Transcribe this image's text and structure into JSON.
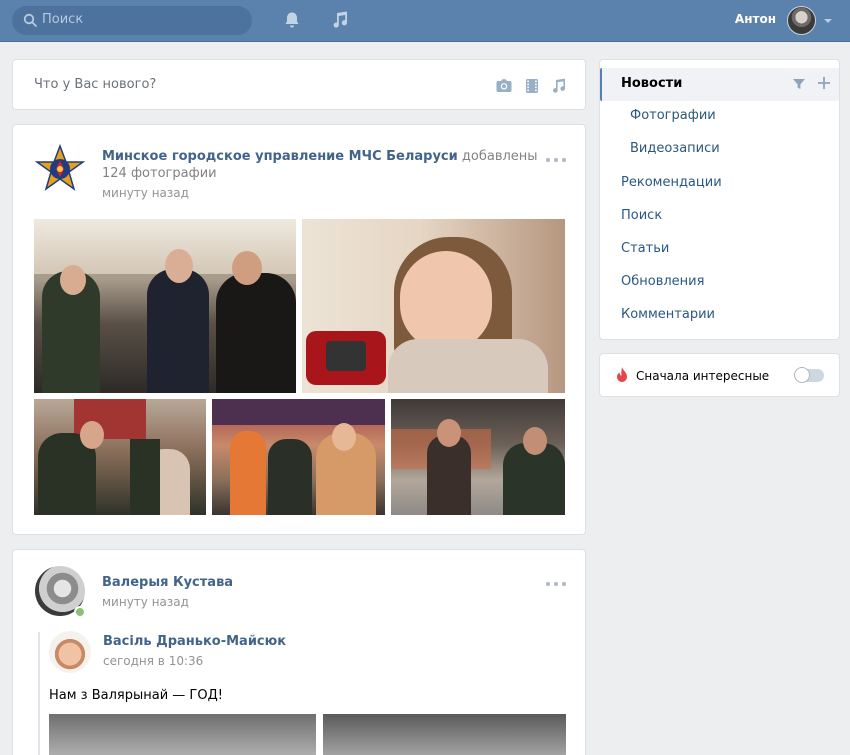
{
  "header": {
    "search_placeholder": "Поиск",
    "user_name": "Антон"
  },
  "composer": {
    "placeholder": "Что у Вас нового?"
  },
  "post1": {
    "author": "Минское городское управление МЧС Беларуси",
    "action": "добавлены 124 фотографии",
    "time": "минуту назад"
  },
  "post2": {
    "author": "Валерыя Кустава",
    "time": "минуту назад",
    "repost": {
      "author": "Васіль Дранько-Майсюк",
      "time": "сегодня в 10:36",
      "text": "Нам з Валярынай — ГОД!"
    }
  },
  "menu": {
    "active": "Новости",
    "items": [
      {
        "label": "Фотографии",
        "sub": true
      },
      {
        "label": "Видеозаписи",
        "sub": true
      },
      {
        "label": "Рекомендации",
        "sub": false
      },
      {
        "label": "Поиск",
        "sub": false
      },
      {
        "label": "Статьи",
        "sub": false
      },
      {
        "label": "Обновления",
        "sub": false
      },
      {
        "label": "Комментарии",
        "sub": false
      }
    ]
  },
  "toggle": {
    "label": "Сначала интересные",
    "on": false
  },
  "colors": {
    "header": "#5b81ad",
    "link": "#42648b",
    "accent": "#5181b8"
  }
}
